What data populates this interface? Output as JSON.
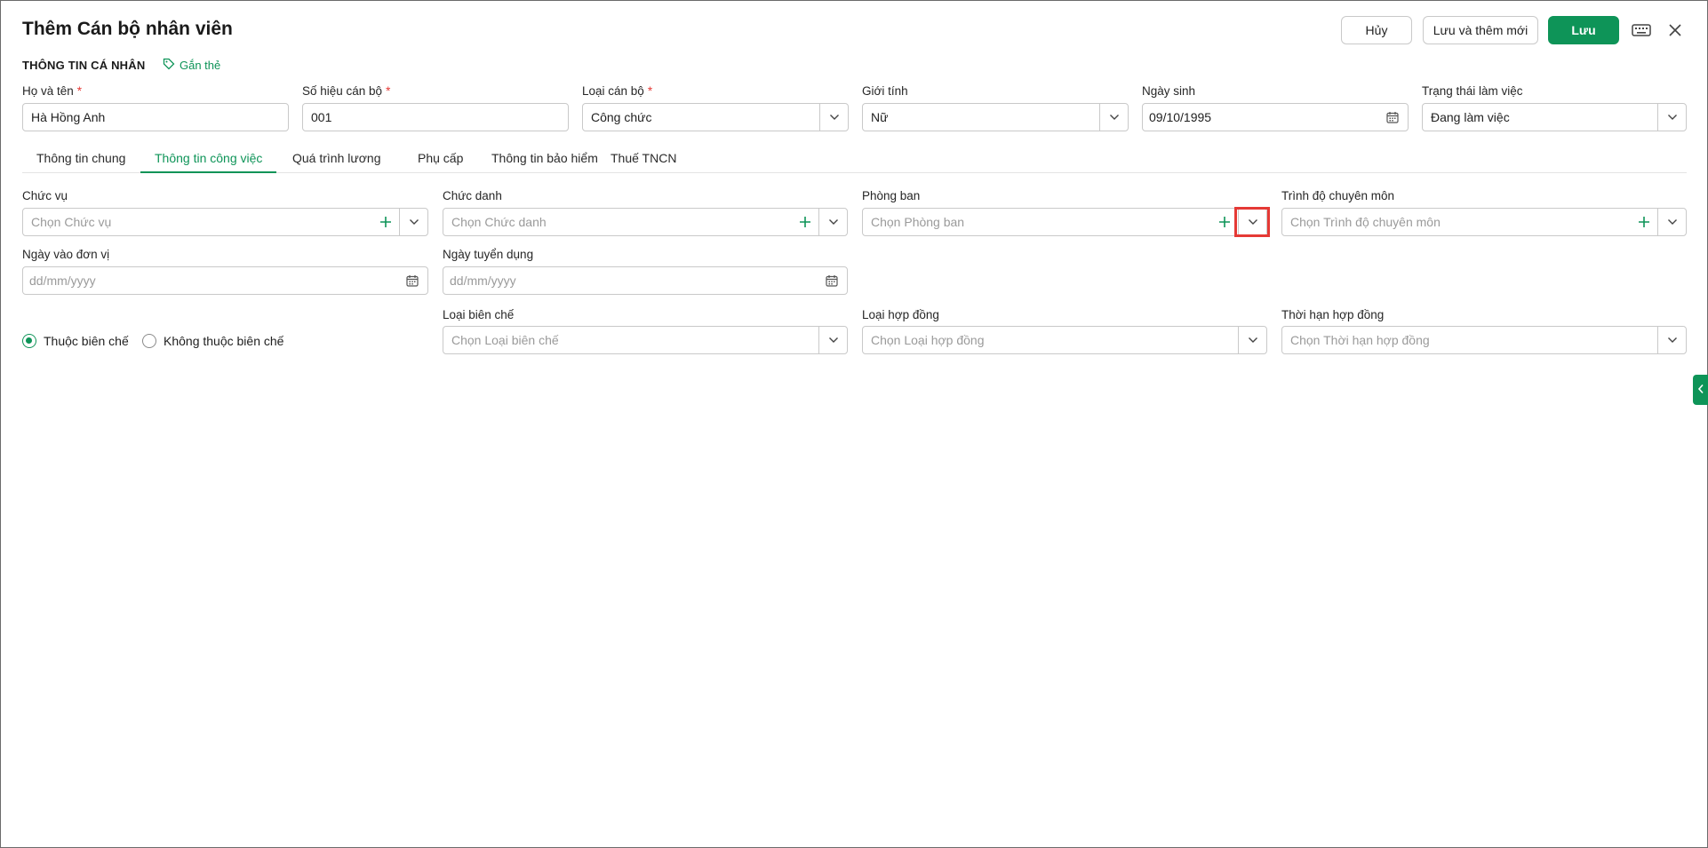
{
  "header": {
    "title": "Thêm Cán bộ nhân viên",
    "cancel_label": "Hủy",
    "save_new_label": "Lưu và thêm mới",
    "save_label": "Lưu"
  },
  "personal": {
    "section_title": "THÔNG TIN CÁ NHÂN",
    "tag_label": "Gắn thẻ",
    "full_name": {
      "label": "Họ và tên",
      "value": "Hà Hồng Anh",
      "required": "*"
    },
    "staff_code": {
      "label": "Số hiệu cán bộ",
      "value": "001",
      "required": "*"
    },
    "staff_type": {
      "label": "Loại cán bộ",
      "value": "Công chức",
      "required": "*"
    },
    "gender": {
      "label": "Giới tính",
      "value": "Nữ"
    },
    "birth_date": {
      "label": "Ngày sinh",
      "value": "09/10/1995"
    },
    "work_status": {
      "label": "Trạng thái làm việc",
      "value": "Đang làm việc"
    }
  },
  "tabs": [
    {
      "label": "Thông tin chung"
    },
    {
      "label": "Thông tin công việc"
    },
    {
      "label": "Quá trình lương"
    },
    {
      "label": "Phụ cấp"
    },
    {
      "label": "Thông tin bảo hiểm"
    },
    {
      "label": "Thuế TNCN"
    }
  ],
  "work": {
    "position": {
      "label": "Chức vụ",
      "placeholder": "Chọn Chức vụ"
    },
    "title": {
      "label": "Chức danh",
      "placeholder": "Chọn Chức danh"
    },
    "department": {
      "label": "Phòng ban",
      "placeholder": "Chọn Phòng ban"
    },
    "qualification": {
      "label": "Trình độ chuyên môn",
      "placeholder": "Chọn Trình độ chuyên môn"
    },
    "join_date": {
      "label": "Ngày vào đơn vị",
      "placeholder": "dd/mm/yyyy"
    },
    "hire_date": {
      "label": "Ngày tuyển dụng",
      "placeholder": "dd/mm/yyyy"
    },
    "radio_on": "Thuộc biên chế",
    "radio_off": "Không thuộc biên chế",
    "staffing_type": {
      "label": "Loại biên chế",
      "placeholder": "Chọn Loại biên chế"
    },
    "contract_type": {
      "label": "Loại hợp đồng",
      "placeholder": "Chọn Loại hợp đồng"
    },
    "contract_term": {
      "label": "Thời hạn hợp đồng",
      "placeholder": "Chọn Thời hạn hợp đồng"
    }
  },
  "colors": {
    "accent": "#0e9458",
    "required": "#e53935",
    "highlight": "#e53935"
  },
  "icons": [
    "keyboard-icon",
    "close-icon",
    "tag-icon",
    "chevron-down-icon",
    "plus-icon",
    "calendar-icon",
    "chevron-left-icon"
  ]
}
